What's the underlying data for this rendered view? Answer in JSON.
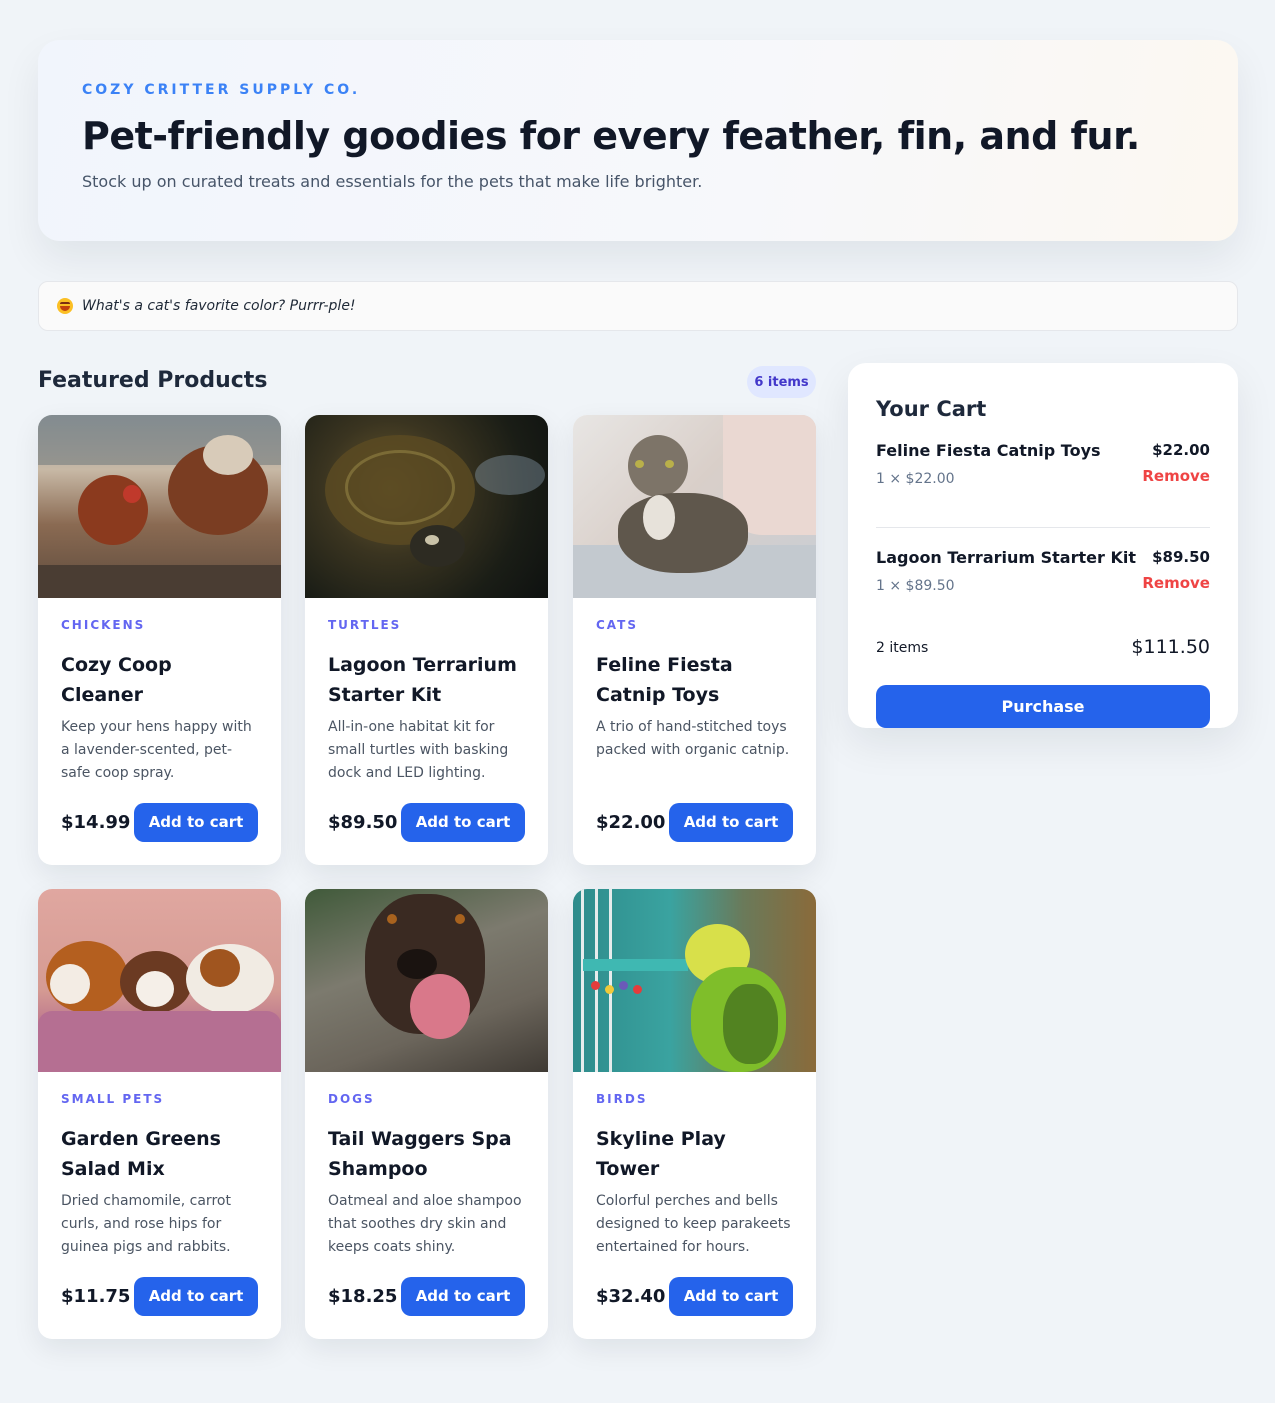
{
  "hero": {
    "brand": "COZY CRITTER SUPPLY CO.",
    "title": "Pet-friendly goodies for every feather, fin, and fur.",
    "subtitle": "Stock up on curated treats and essentials for the pets that make life brighter."
  },
  "joke": {
    "icon": "grinning-emoji-icon",
    "text": "What's a cat's favorite color? Purrr-ple!"
  },
  "products_section": {
    "title": "Featured Products",
    "count_label": "6 items"
  },
  "products": [
    {
      "category": "CHICKENS",
      "name": "Cozy Coop Cleaner",
      "description": "Keep your hens happy with a lavender-scented, pet-safe coop spray.",
      "price": "$14.99",
      "button": "Add to cart",
      "image": "chickens-photo"
    },
    {
      "category": "TURTLES",
      "name": "Lagoon Terrarium Starter Kit",
      "description": "All-in-one habitat kit for small turtles with basking dock and LED lighting.",
      "price": "$89.50",
      "button": "Add to cart",
      "image": "turtle-photo"
    },
    {
      "category": "CATS",
      "name": "Feline Fiesta Catnip Toys",
      "description": "A trio of hand-stitched toys packed with organic catnip.",
      "price": "$22.00",
      "button": "Add to cart",
      "image": "cat-photo"
    },
    {
      "category": "SMALL PETS",
      "name": "Garden Greens Salad Mix",
      "description": "Dried chamomile, carrot curls, and rose hips for guinea pigs and rabbits.",
      "price": "$11.75",
      "button": "Add to cart",
      "image": "guinea-pigs-photo"
    },
    {
      "category": "DOGS",
      "name": "Tail Waggers Spa Shampoo",
      "description": "Oatmeal and aloe shampoo that soothes dry skin and keeps coats shiny.",
      "price": "$18.25",
      "button": "Add to cart",
      "image": "dog-photo"
    },
    {
      "category": "BIRDS",
      "name": "Skyline Play Tower",
      "description": "Colorful perches and bells designed to keep parakeets entertained for hours.",
      "price": "$32.40",
      "button": "Add to cart",
      "image": "parakeet-photo"
    }
  ],
  "cart": {
    "title": "Your Cart",
    "lines": [
      {
        "name": "Feline Fiesta Catnip Toys",
        "qty": "1 × $22.00",
        "total": "$22.00",
        "remove": "Remove"
      },
      {
        "name": "Lagoon Terrarium Starter Kit",
        "qty": "1 × $89.50",
        "total": "$89.50",
        "remove": "Remove"
      }
    ],
    "count": "2 items",
    "total": "$111.50",
    "purchase": "Purchase"
  },
  "colors": {
    "accent": "#2563eb",
    "brand": "#3b82f6",
    "category": "#6366f1",
    "remove": "#ef4444",
    "page_bg": "#f0f4f8"
  }
}
